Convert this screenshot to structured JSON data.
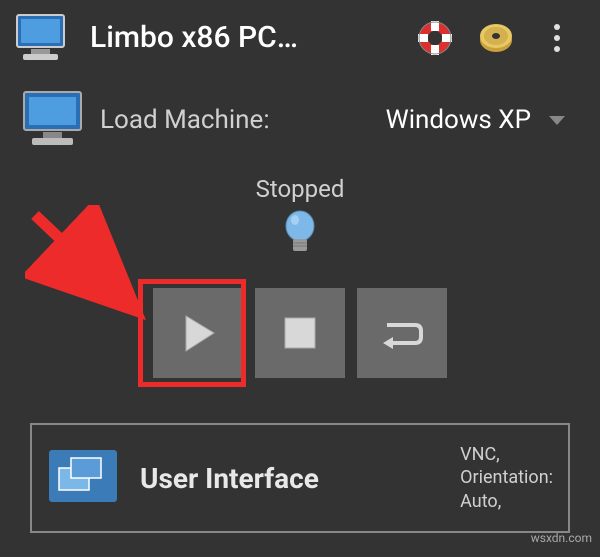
{
  "header": {
    "title": "Limbo x86 PC…"
  },
  "load": {
    "label": "Load Machine:",
    "selected": "Windows XP"
  },
  "status": {
    "label": "Stopped"
  },
  "section": {
    "title": "User Interface",
    "detail1": "VNC,",
    "detail2": "Orientation:",
    "detail3": "Auto,"
  },
  "watermark": "wsxdn.com"
}
